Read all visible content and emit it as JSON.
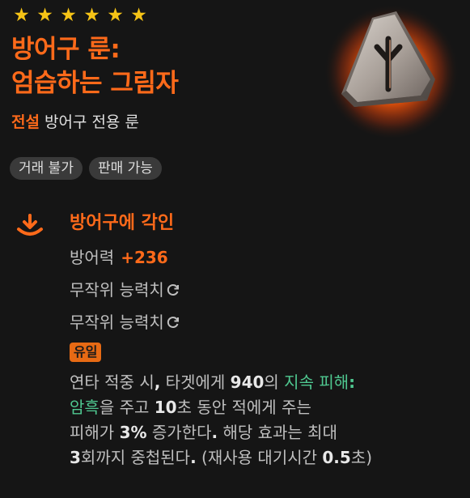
{
  "rating": {
    "stars": 6,
    "star_glyph": "★",
    "star_color": "#f5c316"
  },
  "item": {
    "name_line1": "방어구 룬:",
    "name_line2": "엄습하는 그림자",
    "grade": "전설",
    "type": "방어구 전용 룬",
    "grade_color": "#ff6a1a",
    "icon": "rune-stone-icon"
  },
  "tags": [
    "거래 불가",
    "판매 가능"
  ],
  "engrave": {
    "icon": "download-arrow-icon",
    "title": "방어구에 각인",
    "stat_label": "방어력",
    "stat_value": "+236",
    "random_stat_1": "무작위 능력치",
    "random_stat_2": "무작위 능력치",
    "reroll_icon": "reroll-icon"
  },
  "effect": {
    "badge": "유일",
    "badge_color": "#e76a14",
    "l1_a": "연타 적중 시",
    "l1_b": ",",
    "l1_c": " 타겟에게 ",
    "l1_d": "940",
    "l1_e": "의 ",
    "l1_f": "지속 피해",
    "l1_g": ":",
    "l2_a": "암흑",
    "l2_b": "을 주고 ",
    "l2_c": "10",
    "l2_d": "초 동안 적에게 주는",
    "l3_a": "피해가 ",
    "l3_b": "3%",
    "l3_c": " 증가한다",
    "l3_d": ".",
    "l3_e": " 해당 효과는 최대",
    "l4_a": "3",
    "l4_b": "회까지 중첩된다",
    "l4_c": ".",
    "l4_d": " (재사용 대기시간 ",
    "l4_e": "0.5",
    "l4_f": "초)",
    "highlight_color": "#4fc890"
  }
}
